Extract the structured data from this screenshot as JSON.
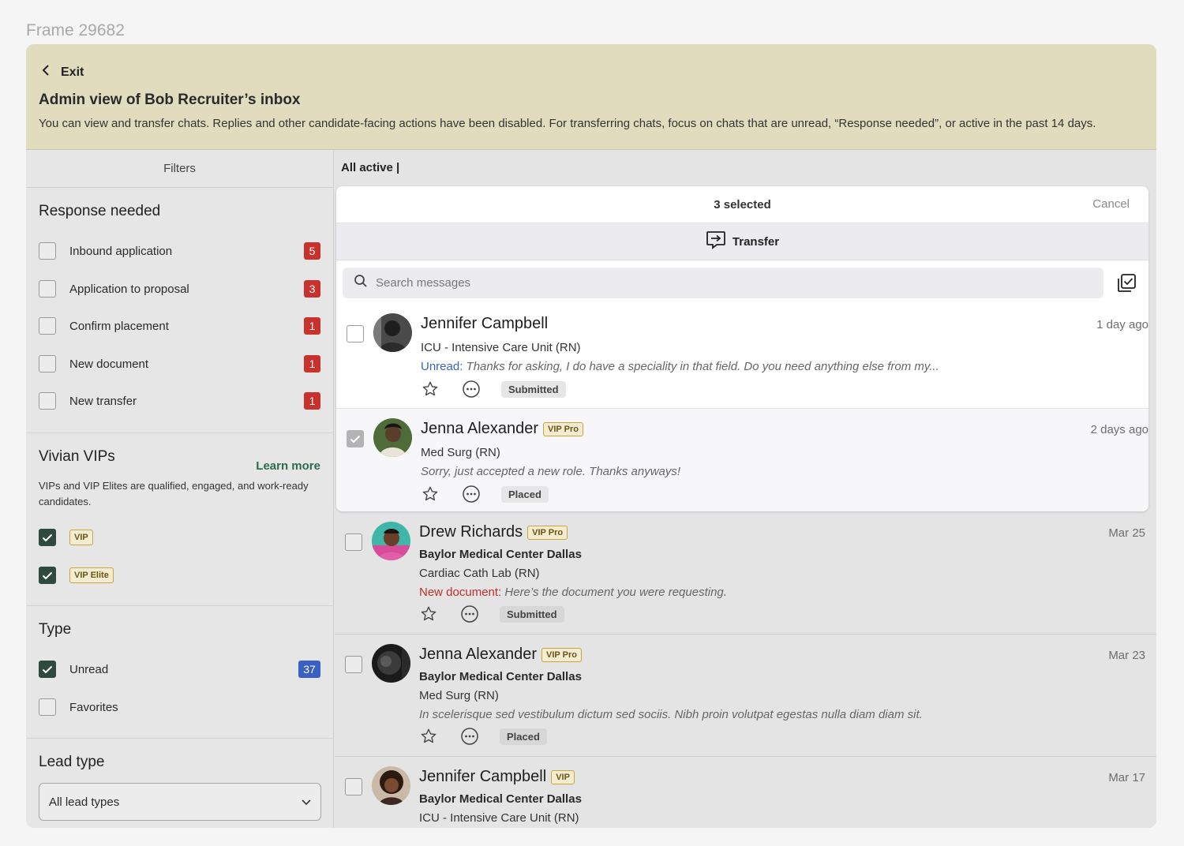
{
  "frame_label": "Frame 29682",
  "banner": {
    "exit_label": "Exit",
    "title": "Admin view of Bob Recruiter’s inbox",
    "description": "You can view and transfer chats. Replies and other candidate-facing actions have been disabled. For transferring chats, focus on chats that are unread, “Response needed”, or active in the past 14 days."
  },
  "sidebar": {
    "header": "Filters",
    "response_needed": {
      "title": "Response needed",
      "items": [
        {
          "label": "Inbound application",
          "count": "5",
          "checked": false
        },
        {
          "label": "Application to proposal",
          "count": "3",
          "checked": false
        },
        {
          "label": "Confirm placement",
          "count": "1",
          "checked": false
        },
        {
          "label": "New document",
          "count": "1",
          "checked": false
        },
        {
          "label": "New transfer",
          "count": "1",
          "checked": false
        }
      ]
    },
    "vips": {
      "title": "Vivian VIPs",
      "learn_more": "Learn more",
      "description": "VIPs and VIP Elites are qualified, engaged, and work-ready candidates.",
      "items": [
        {
          "label": "VIP",
          "checked": true
        },
        {
          "label": "VIP Elite",
          "checked": true
        }
      ]
    },
    "type": {
      "title": "Type",
      "items": [
        {
          "label": "Unread",
          "count": "37",
          "checked": true
        },
        {
          "label": "Favorites",
          "checked": false
        }
      ]
    },
    "lead_type": {
      "title": "Lead type",
      "selected": "All lead types"
    }
  },
  "main": {
    "view_label": "All active |",
    "selection": {
      "count_label": "3 selected",
      "cancel_label": "Cancel",
      "transfer_label": "Transfer"
    },
    "search_placeholder": "Search messages",
    "conversations": [
      {
        "name": "Jennifer Campbell",
        "badge": "",
        "date": "1 day ago",
        "facility": "",
        "role": "ICU - Intensive Care Unit (RN)",
        "msg_label": "Unread:",
        "message": "Thanks for asking, I do have a speciality in that field. Do you need anything else from my...",
        "status": "Submitted",
        "checked": false
      },
      {
        "name": "Jenna Alexander",
        "badge": "VIP Pro",
        "date": "2 days ago",
        "facility": "",
        "role": "Med Surg (RN)",
        "msg_label": "",
        "message": "Sorry, just accepted a new role. Thanks anyways!",
        "status": "Placed",
        "checked": true
      },
      {
        "name": "Drew Richards",
        "badge": "VIP Pro",
        "date": "Mar 25",
        "facility": "Baylor Medical Center Dallas",
        "role": "Cardiac Cath Lab (RN)",
        "msg_label": "New document:",
        "message": "Here’s the document you were requesting.",
        "status": "Submitted",
        "checked": false
      },
      {
        "name": "Jenna Alexander",
        "badge": "VIP Pro",
        "date": "Mar 23",
        "facility": "Baylor Medical Center Dallas",
        "role": "Med Surg (RN)",
        "msg_label": "",
        "message": "In scelerisque sed vestibulum dictum sed sociis. Nibh proin volutpat egestas nulla diam diam sit.",
        "status": "Placed",
        "checked": false
      },
      {
        "name": "Jennifer Campbell",
        "badge": "VIP",
        "date": "Mar 17",
        "facility": "Baylor Medical Center Dallas",
        "role": "ICU - Intensive Care Unit (RN)",
        "msg_label": "",
        "message": "",
        "status": "",
        "checked": false
      }
    ]
  },
  "colors": {
    "banner_bg": "#e2dcbf",
    "checkbox_on": "#2e4a3e",
    "count_red": "#c9322c",
    "count_blue": "#3a5fc4",
    "unread_blue": "#3a63c5",
    "new_doc_red": "#c22e2a",
    "learn_more_green": "#2d6c4a"
  }
}
